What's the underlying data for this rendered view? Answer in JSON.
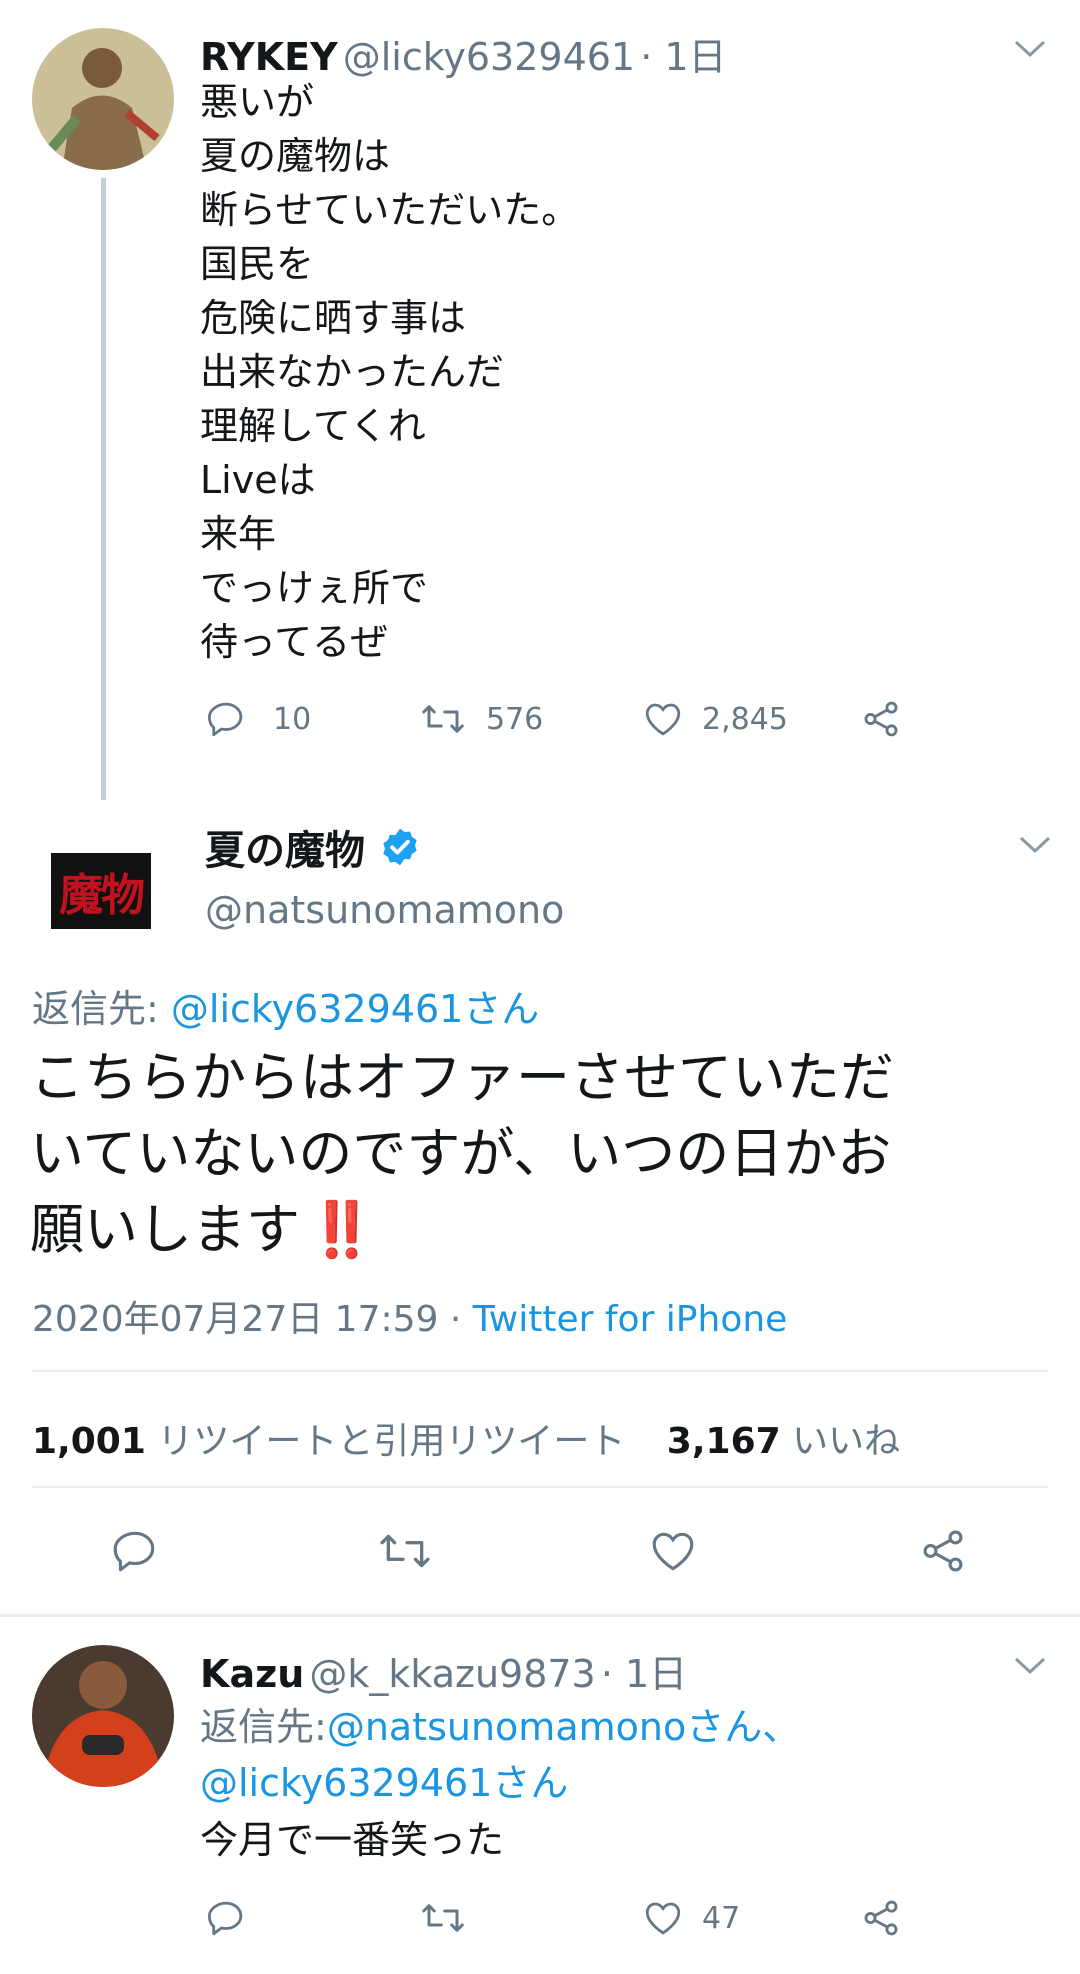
{
  "tweet1": {
    "display_name": "RYKEY",
    "handle": "@licky6329461",
    "time": "· 1日",
    "lines": [
      "悪いが",
      "夏の魔物は",
      "断らせていただいた。",
      "国民を",
      "危険に晒す事は",
      "出来なかったんだ",
      "理解してくれ",
      "Liveは",
      "来年",
      "でっけぇ所で",
      "待ってるぜ"
    ],
    "replies": "10",
    "retweets": "576",
    "likes": "2,845"
  },
  "main_tweet": {
    "display_name": "夏の魔物",
    "handle": "@natsunomamono",
    "logo_text": "魔物",
    "reply_label": "返信先:",
    "reply_to": "@licky6329461さん",
    "text_lines": [
      "こちらからはオファーさせていただ",
      "いていないのですが、いつの日かお",
      "願いします"
    ],
    "emoji": "‼️",
    "timestamp": "2020年07月27日 17:59 ·",
    "source": "Twitter for iPhone",
    "retweet_count": "1,001",
    "retweet_label": "リツイートと引用リツイート",
    "like_count": "3,167",
    "like_label": "いいね"
  },
  "tweet3": {
    "display_name": "Kazu",
    "handle": "@k_kkazu9873",
    "time": "· 1日",
    "reply_label": "返信先:",
    "reply_to_1": "@natsunomamonoさん、",
    "reply_to_2": "@licky6329461さん",
    "text": "今月で一番笑った",
    "likes": "47"
  },
  "colors": {
    "link": "#1b95e0",
    "secondary": "#657786",
    "verified": "#1da1f2",
    "divider": "#e6ecf0",
    "emoji_red": "#cc1f2f"
  }
}
